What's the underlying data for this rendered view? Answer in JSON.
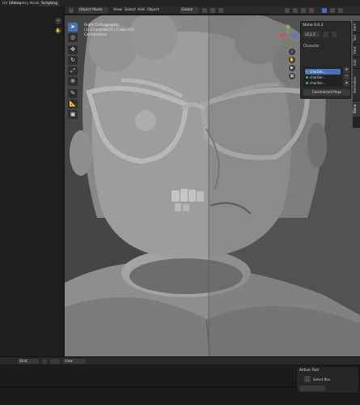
{
  "top_tabs": [
    "UV Editing",
    "Geometry Nodes",
    "Scripting"
  ],
  "viewport_header": {
    "mode_label": "Object Mode",
    "menus": [
      "View",
      "Select",
      "Add",
      "Object"
    ],
    "transform_orientation": "Global"
  },
  "overlay": {
    "view_name": "Right Orthographic",
    "collection_line": "(3) Character01 | Cube.003",
    "units": "Centimeters"
  },
  "toolbar_tools": [
    "select-box",
    "cursor",
    "move",
    "rotate",
    "scale",
    "transform",
    "annotate",
    "measure",
    "add-cube"
  ],
  "n_panel": {
    "title": "Shino 0.0.2",
    "version_field": "v2.2.3",
    "section_label": "Character",
    "list_items": [
      "charGer...",
      "charGer...",
      "charSto..."
    ],
    "bottom_button": "Constrained Props"
  },
  "sidebar_tabs": [
    "Item",
    "Tool",
    "View",
    "Edit",
    "Animation",
    "Shino"
  ],
  "timeline": {
    "playback_label": "Strat",
    "view_label": "View"
  },
  "active_tool": {
    "header": "Active Tool",
    "tool_name": "Select Box"
  },
  "colors": {
    "accent": "#4772b3",
    "viewport_bg": "#454545",
    "clay": "#9a9a9a"
  }
}
